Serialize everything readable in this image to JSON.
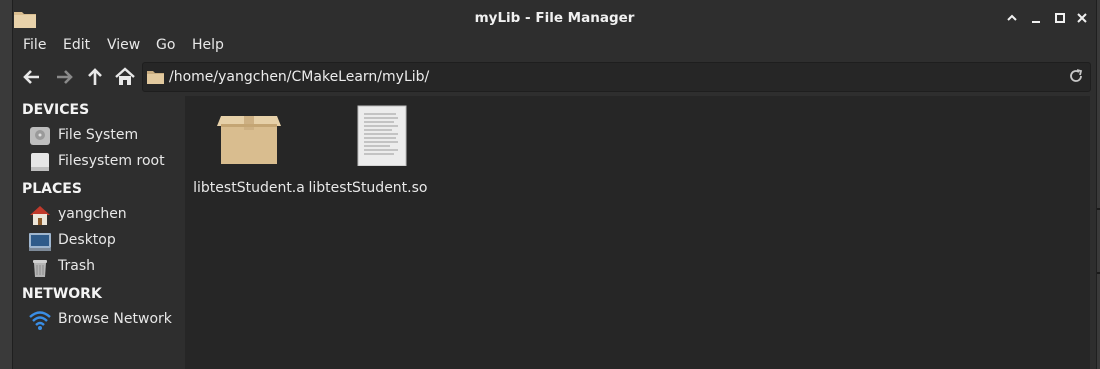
{
  "window": {
    "title": "myLib - File Manager",
    "controls": [
      "minimize-up",
      "minimize",
      "maximize",
      "close"
    ]
  },
  "menu": [
    "File",
    "Edit",
    "View",
    "Go",
    "Help"
  ],
  "toolbar": {
    "location_path": "/home/yangchen/CMakeLearn/myLib/"
  },
  "sidebar": {
    "sections": [
      {
        "title": "DEVICES",
        "items": [
          {
            "label": "File System",
            "icon": "drive-icon"
          },
          {
            "label": "Filesystem root",
            "icon": "drive-root-icon"
          }
        ]
      },
      {
        "title": "PLACES",
        "items": [
          {
            "label": "yangchen",
            "icon": "home-icon"
          },
          {
            "label": "Desktop",
            "icon": "desktop-icon"
          },
          {
            "label": "Trash",
            "icon": "trash-icon"
          }
        ]
      },
      {
        "title": "NETWORK",
        "items": [
          {
            "label": "Browse Network",
            "icon": "network-icon"
          }
        ]
      }
    ]
  },
  "files": [
    {
      "name": "libtestStudent.a",
      "icon": "package-icon"
    },
    {
      "name": "libtestStudent.so",
      "icon": "document-icon"
    }
  ],
  "colors": {
    "window_bg": "#2e2e2e",
    "content_bg": "#262626",
    "text": "#e8e8e8",
    "folder_tan": "#d6b98c"
  }
}
